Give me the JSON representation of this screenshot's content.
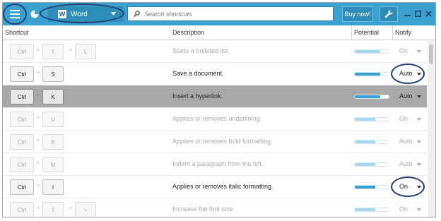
{
  "toolbar": {
    "app_name": "Word",
    "app_logo": "W",
    "search_placeholder": "Search shortcuts",
    "buy_label": "Buy now!",
    "icons": [
      "menu-icon",
      "pie-chart-icon",
      "chevron-down-icon",
      "search-icon",
      "wrench-icon",
      "minimize-icon",
      "maximize-icon",
      "close-icon"
    ]
  },
  "header": {
    "shortcut": "Shortcut",
    "description": "Description",
    "potential": "Potential",
    "notify": "Notify"
  },
  "rows": [
    {
      "keys": [
        "Ctrl",
        "⇧",
        "L"
      ],
      "description": "Starts a bulleted list.",
      "potential": 0.75,
      "notify": "On",
      "faded": true,
      "selected": false
    },
    {
      "keys": [
        "Ctrl",
        "S"
      ],
      "description": "Save a document.",
      "potential": 0.75,
      "notify": "Auto",
      "faded": false,
      "selected": false
    },
    {
      "keys": [
        "Ctrl",
        "K"
      ],
      "description": "Insert a hyperlink.",
      "potential": 0.75,
      "notify": "Auto",
      "faded": false,
      "selected": true
    },
    {
      "keys": [
        "Ctrl",
        "U"
      ],
      "description": "Applies or removes underlining.",
      "potential": 0.6,
      "notify": "On",
      "faded": true,
      "selected": false
    },
    {
      "keys": [
        "Ctrl",
        "B"
      ],
      "description": "Applies or removes bold formatting.",
      "potential": 0.6,
      "notify": "Auto",
      "faded": true,
      "selected": false
    },
    {
      "keys": [
        "Ctrl",
        "M"
      ],
      "description": "Indent a paragraph from the left.",
      "potential": 0.6,
      "notify": "Auto",
      "faded": true,
      "selected": false
    },
    {
      "keys": [
        "Ctrl",
        "I"
      ],
      "description": "Applies or removes italic formatting.",
      "potential": 0.6,
      "notify": "On",
      "faded": false,
      "selected": false
    },
    {
      "keys": [
        "Ctrl",
        "⇧",
        ">"
      ],
      "description": "Increase the font size.",
      "potential": 0.6,
      "notify": "On",
      "faded": true,
      "selected": false
    }
  ],
  "colors": {
    "accent": "#3aa0cf",
    "highlight_circle": "#1f3f73",
    "selected_row": "#a9a9a9"
  }
}
